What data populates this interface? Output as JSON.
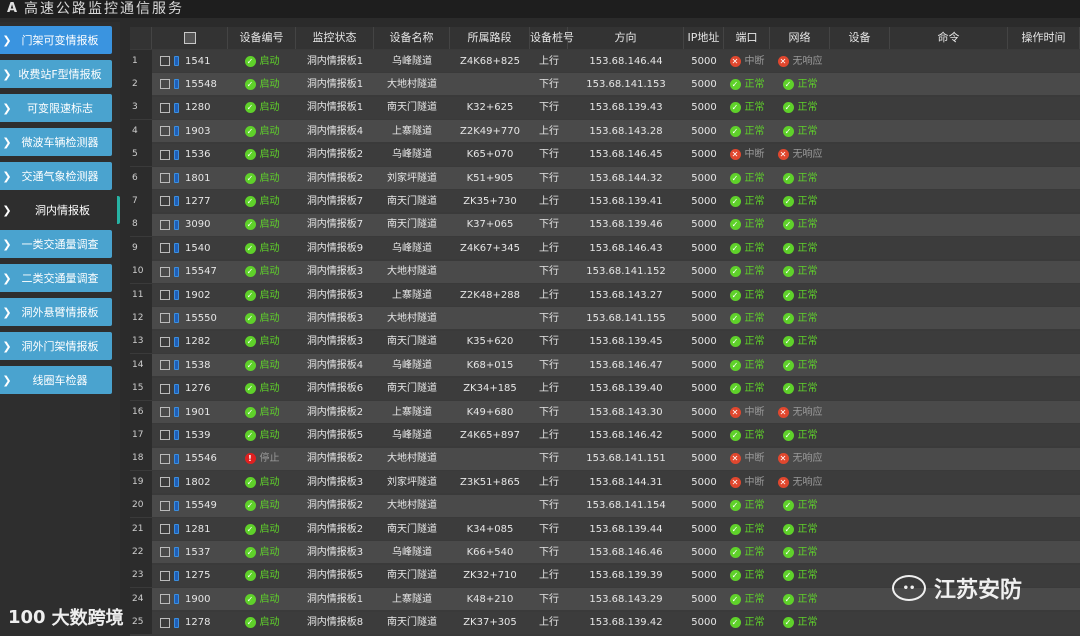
{
  "app": {
    "logo": "A",
    "title": "高速公路监控通信服务"
  },
  "sidebar": [
    "门架可变情报板",
    "收费站F型情报板",
    "可变限速标志",
    "微波车辆检测器",
    "交通气象检测器",
    "洞内情报板",
    "一类交通量调查",
    "二类交通量调查",
    "洞外悬臂情报板",
    "洞外门架情报板",
    "线圈车检器"
  ],
  "columns": [
    "",
    "设备编号",
    "监控状态",
    "设备名称",
    "所属路段",
    "设备桩号",
    "方向",
    "IP地址",
    "端口",
    "网络",
    "设备",
    "命令",
    "操作时间"
  ],
  "rows": [
    [
      "1",
      "1541",
      "启动",
      "洞内情报板1",
      "乌峰隧道",
      "Z4K68+825",
      "上行",
      "153.68.146.44",
      "5000",
      "中断",
      "无响应"
    ],
    [
      "2",
      "15548",
      "启动",
      "洞内情报板1",
      "大地村隧道",
      "",
      "下行",
      "153.68.141.153",
      "5000",
      "正常",
      "正常"
    ],
    [
      "3",
      "1280",
      "启动",
      "洞内情报板1",
      "南天门隧道",
      "K32+625",
      "下行",
      "153.68.139.43",
      "5000",
      "正常",
      "正常"
    ],
    [
      "4",
      "1903",
      "启动",
      "洞内情报板4",
      "上寨隧道",
      "Z2K49+770",
      "上行",
      "153.68.143.28",
      "5000",
      "正常",
      "正常"
    ],
    [
      "5",
      "1536",
      "启动",
      "洞内情报板2",
      "乌峰隧道",
      "K65+070",
      "下行",
      "153.68.146.45",
      "5000",
      "中断",
      "无响应"
    ],
    [
      "6",
      "1801",
      "启动",
      "洞内情报板2",
      "刘家坪隧道",
      "K51+905",
      "下行",
      "153.68.144.32",
      "5000",
      "正常",
      "正常"
    ],
    [
      "7",
      "1277",
      "启动",
      "洞内情报板7",
      "南天门隧道",
      "ZK35+730",
      "上行",
      "153.68.139.41",
      "5000",
      "正常",
      "正常"
    ],
    [
      "8",
      "3090",
      "启动",
      "洞内情报板7",
      "南天门隧道",
      "K37+065",
      "下行",
      "153.68.139.46",
      "5000",
      "正常",
      "正常"
    ],
    [
      "9",
      "1540",
      "启动",
      "洞内情报板9",
      "乌峰隧道",
      "Z4K67+345",
      "上行",
      "153.68.146.43",
      "5000",
      "正常",
      "正常"
    ],
    [
      "10",
      "15547",
      "启动",
      "洞内情报板3",
      "大地村隧道",
      "",
      "下行",
      "153.68.141.152",
      "5000",
      "正常",
      "正常"
    ],
    [
      "11",
      "1902",
      "启动",
      "洞内情报板3",
      "上寨隧道",
      "Z2K48+288",
      "上行",
      "153.68.143.27",
      "5000",
      "正常",
      "正常"
    ],
    [
      "12",
      "15550",
      "启动",
      "洞内情报板3",
      "大地村隧道",
      "",
      "下行",
      "153.68.141.155",
      "5000",
      "正常",
      "正常"
    ],
    [
      "13",
      "1282",
      "启动",
      "洞内情报板3",
      "南天门隧道",
      "K35+620",
      "下行",
      "153.68.139.45",
      "5000",
      "正常",
      "正常"
    ],
    [
      "14",
      "1538",
      "启动",
      "洞内情报板4",
      "乌峰隧道",
      "K68+015",
      "下行",
      "153.68.146.47",
      "5000",
      "正常",
      "正常"
    ],
    [
      "15",
      "1276",
      "启动",
      "洞内情报板6",
      "南天门隧道",
      "ZK34+185",
      "上行",
      "153.68.139.40",
      "5000",
      "正常",
      "正常"
    ],
    [
      "16",
      "1901",
      "启动",
      "洞内情报板2",
      "上寨隧道",
      "K49+680",
      "下行",
      "153.68.143.30",
      "5000",
      "中断",
      "无响应"
    ],
    [
      "17",
      "1539",
      "启动",
      "洞内情报板5",
      "乌峰隧道",
      "Z4K65+897",
      "上行",
      "153.68.146.42",
      "5000",
      "正常",
      "正常"
    ],
    [
      "18",
      "15546",
      "停止",
      "洞内情报板2",
      "大地村隧道",
      "",
      "下行",
      "153.68.141.151",
      "5000",
      "中断",
      "无响应"
    ],
    [
      "19",
      "1802",
      "启动",
      "洞内情报板3",
      "刘家坪隧道",
      "Z3K51+865",
      "上行",
      "153.68.144.31",
      "5000",
      "中断",
      "无响应"
    ],
    [
      "20",
      "15549",
      "启动",
      "洞内情报板2",
      "大地村隧道",
      "",
      "下行",
      "153.68.141.154",
      "5000",
      "正常",
      "正常"
    ],
    [
      "21",
      "1281",
      "启动",
      "洞内情报板2",
      "南天门隧道",
      "K34+085",
      "下行",
      "153.68.139.44",
      "5000",
      "正常",
      "正常"
    ],
    [
      "22",
      "1537",
      "启动",
      "洞内情报板3",
      "乌峰隧道",
      "K66+540",
      "下行",
      "153.68.146.46",
      "5000",
      "正常",
      "正常"
    ],
    [
      "23",
      "1275",
      "启动",
      "洞内情报板5",
      "南天门隧道",
      "ZK32+710",
      "上行",
      "153.68.139.39",
      "5000",
      "正常",
      "正常"
    ],
    [
      "24",
      "1900",
      "启动",
      "洞内情报板1",
      "上寨隧道",
      "K48+210",
      "下行",
      "153.68.143.29",
      "5000",
      "正常",
      "正常"
    ],
    [
      "25",
      "1278",
      "启动",
      "洞内情报板8",
      "南天门隧道",
      "ZK37+305",
      "上行",
      "153.68.139.42",
      "5000",
      "正常",
      "正常"
    ]
  ],
  "watermarks": {
    "left": "大数跨境",
    "left_logo": "100",
    "right": "江苏安防"
  },
  "colors": {
    "nav": "#4aa3cf",
    "nav_selected": "#3a94e0",
    "ok": "#5fd12a",
    "err": "#e0472e"
  }
}
